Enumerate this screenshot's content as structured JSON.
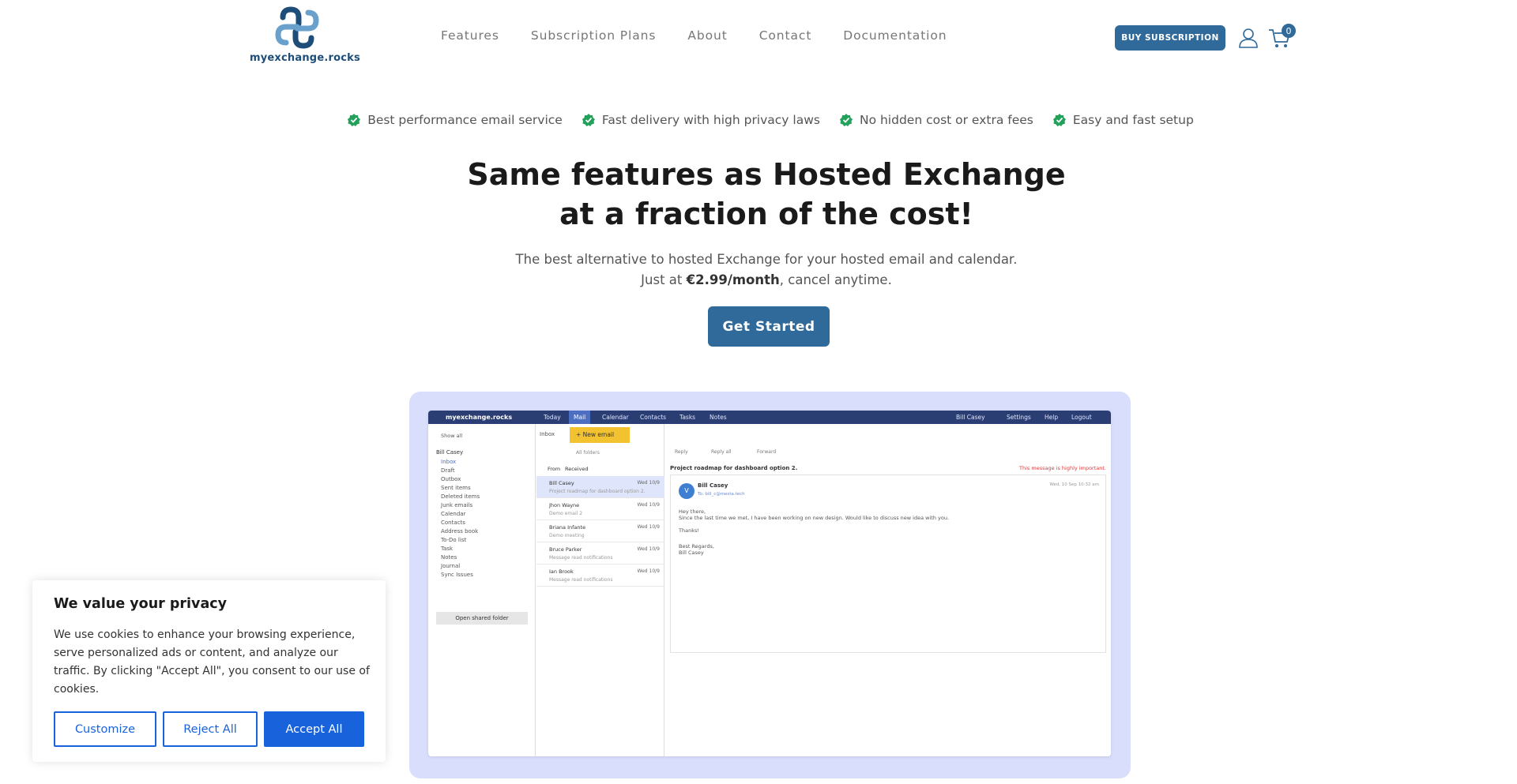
{
  "header": {
    "logo_text": "myexchange.rocks",
    "nav": [
      "Features",
      "Subscription Plans",
      "About",
      "Contact",
      "Documentation"
    ],
    "buy_label": "BUY SUBSCRIPTION",
    "cart_count": "0"
  },
  "features": [
    "Best performance email service",
    "Fast delivery with high privacy laws",
    "No hidden cost or extra fees",
    "Easy and fast setup"
  ],
  "hero": {
    "title_line1": "Same features as Hosted Exchange",
    "title_line2": "at a fraction of the cost!",
    "sub_line1": "The best alternative to hosted Exchange for your hosted email and calendar.",
    "sub_prefix": "Just at ",
    "sub_price": "€2.99/month",
    "sub_suffix": ", cancel anytime.",
    "cta_label": "Get Started"
  },
  "mockup": {
    "brand": "myexchange.rocks",
    "tabs": [
      "Today",
      "Mail",
      "Calendar",
      "Contacts",
      "Tasks",
      "Notes"
    ],
    "user": "Bill Casey",
    "top_right": [
      "Settings",
      "Help",
      "Logout"
    ],
    "show_all": "Show all",
    "inbox_label": "Inbox",
    "new_email": "+ New email",
    "tree_root": "Bill Casey",
    "folders": [
      "Inbox",
      "Draft",
      "Outbox",
      "Sent items",
      "Deleted items",
      "Junk emails",
      "Calendar",
      "Contacts",
      "Address book",
      "To-Do list",
      "Task",
      "Notes",
      "Journal",
      "Sync Issues"
    ],
    "open_shared": "Open shared folder",
    "list_from": "From",
    "list_received": "Received",
    "all_folders": "All folders",
    "mails": [
      {
        "from": "Bill Casey",
        "date": "Wed 10/9",
        "subject": "Project roadmap for dashboard option 2."
      },
      {
        "from": "Jhon Wayne",
        "date": "Wed 10/9",
        "subject": "Demo email 2"
      },
      {
        "from": "Briana Infante",
        "date": "Wed 10/9",
        "subject": "Demo meeting"
      },
      {
        "from": "Bruce Parker",
        "date": "Wed 10/9",
        "subject": "Message read notifications"
      },
      {
        "from": "Ian Brook",
        "date": "Wed 10/9",
        "subject": "Message read notifications"
      }
    ],
    "actions": [
      "Reply",
      "Reply all",
      "Forward"
    ],
    "reader_subject": "Project roadmap for dashboard option 2.",
    "important_note": "This message is highly important.",
    "reader_from": "Bill Casey",
    "reader_to": "To: bill_c@mesta.tech",
    "reader_date": "Wed, 10 Sep 10:32 am",
    "avatar_letter": "V",
    "body_greeting": "Hey there,",
    "body_text": "Since the last time we met, I have been working on new design. Would like to discuss new idea with you.",
    "body_thanks": "Thanks!",
    "body_regards": "Best Regards,",
    "body_sign": "Bill Casey"
  },
  "cookie": {
    "title": "We value your privacy",
    "text": "We use cookies to enhance your browsing experience, serve personalized ads or content, and analyze our traffic. By clicking \"Accept All\", you consent to our use of cookies.",
    "customize": "Customize",
    "reject": "Reject All",
    "accept": "Accept All"
  },
  "colors": {
    "primary": "#2f6a9a",
    "check_green": "#22a15a",
    "cookie_blue": "#1863dc",
    "mock_frame": "#d9defc"
  }
}
